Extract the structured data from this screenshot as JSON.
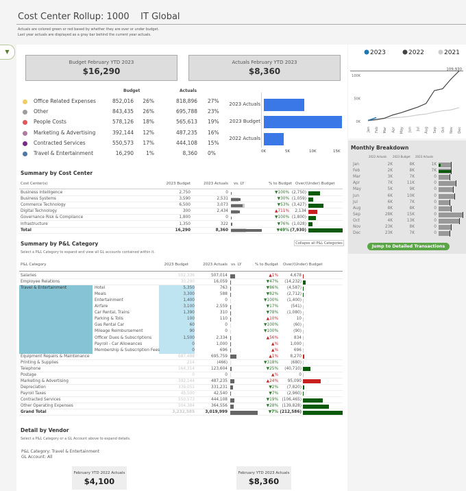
{
  "header": {
    "title": "Cost Center Rollup: 1000    IT Global",
    "note1": "Actuals are colored green or red based by whether they are over or under budget.",
    "note2": "Last year actuals are displayed as a gray bar behind the current year actuals.",
    "filter_icon": "filter-icon"
  },
  "kpis": [
    {
      "label": "Budget February YTD 2023",
      "value": "$16,290"
    },
    {
      "label": "Actuals February YTD 2023",
      "value": "$8,360"
    }
  ],
  "summary": {
    "budget_header": "Budget",
    "actuals_header": "Actuals",
    "rows": [
      {
        "label": "Office Related Expenses",
        "budget": "852,016",
        "bpct": "26%",
        "actual": "818,896",
        "apct": "27%",
        "color": "#f1ce63"
      },
      {
        "label": "Other",
        "budget": "843,435",
        "bpct": "26%",
        "actual": "695,788",
        "apct": "23%",
        "color": "#9d9d9d"
      },
      {
        "label": "People Costs",
        "budget": "578,126",
        "bpct": "18%",
        "actual": "565,613",
        "apct": "19%",
        "color": "#e15759"
      },
      {
        "label": "Marketing & Advertising",
        "budget": "392,144",
        "bpct": "12%",
        "actual": "487,235",
        "apct": "16%",
        "color": "#b07aa1"
      },
      {
        "label": "Contracted Services",
        "budget": "550,573",
        "bpct": "17%",
        "actual": "444,108",
        "apct": "15%",
        "color": "#7b2a8c"
      },
      {
        "label": "Travel & Entertainment",
        "budget": "16,290",
        "bpct": "1%",
        "actual": "8,360",
        "apct": "0%",
        "color": "#4e79a7"
      }
    ]
  },
  "ytd_chart": {
    "bars": [
      {
        "label": "2023 Actuals",
        "value": 8360
      },
      {
        "label": "2023 Budget",
        "value": 16290
      },
      {
        "label": "2022 Actuals",
        "value": 4100
      }
    ],
    "ticks": [
      "0K",
      "5K",
      "10K",
      "15K"
    ],
    "max": 15000,
    "color": "#3b78e7"
  },
  "cost_center": {
    "title": "Summary by Cost Center",
    "headers": [
      "Cost Center(s)",
      "2023 Budget",
      "2023 Actuals",
      "vs. LY",
      "% to Budget",
      "Over/(Under) Budget"
    ],
    "rows": [
      {
        "name": "Business Intelligence",
        "budget": "2,750",
        "actual": "0",
        "ly": 0,
        "lyprev": 0,
        "pct": "▼100%",
        "up": false,
        "over": "(2,750)",
        "ov": -2750
      },
      {
        "name": "Business Systems",
        "budget": "3,590",
        "actual": "2,531",
        "ly": 2531,
        "lyprev": 2000,
        "pct": "▼30%",
        "up": false,
        "over": "(1,059)",
        "ov": -1059
      },
      {
        "name": "Commerce Technology",
        "budget": "6,500",
        "actual": "3,073",
        "ly": 3073,
        "lyprev": 3700,
        "pct": "▼53%",
        "up": false,
        "over": "(3,427)",
        "ov": -3427
      },
      {
        "name": "Digital Technology",
        "budget": "300",
        "actual": "2,434",
        "ly": 2434,
        "lyprev": 1800,
        "pct": "▲711%",
        "up": true,
        "over": "2,134",
        "ov": 2134
      },
      {
        "name": "Governance Risk & Compliance",
        "budget": "1,800",
        "actual": "0",
        "ly": 0,
        "lyprev": 0,
        "pct": "▼100%",
        "up": false,
        "over": "(1,800)",
        "ov": -1800
      },
      {
        "name": "Infrastructure",
        "budget": "1,350",
        "actual": "322",
        "ly": 322,
        "lyprev": 300,
        "pct": "▼76%",
        "up": false,
        "over": "(1,028)",
        "ov": -1028
      },
      {
        "name": "Total",
        "budget": "16,290",
        "actual": "8,360",
        "ly": 8360,
        "lyprev": 4100,
        "pct": "▼49%",
        "up": false,
        "over": "(7,930)",
        "ov": -7930,
        "bold": true
      }
    ]
  },
  "pl": {
    "title": "Summary by P&L Category",
    "subtitle": "Select a P&L Category to expand and view all GL accounts contained within it.",
    "collapse_label": "Collapse all P&L Categories",
    "headers": [
      "P&L Category",
      "2023 Budget",
      "2023 Actuals",
      "vs. LY",
      "% to Budget",
      "Over/(Under) Budget"
    ],
    "expanded_category": "Travel & Entertainment",
    "rows": [
      {
        "cat": "Salaries",
        "budget": "502,336",
        "actual": "507,014",
        "ly": 507014,
        "pct": "▲1%",
        "up": true,
        "over": "4,678",
        "ov": 4678
      },
      {
        "cat": "Employee Relations",
        "budget": "30,290",
        "actual": "16,059",
        "ly": 16059,
        "pct": "▼47%",
        "up": false,
        "over": "(14,232)",
        "ov": -14232
      },
      {
        "sub": "Hotel",
        "budget": "5,350",
        "actual": "763",
        "ly": 763,
        "pct": "▼86%",
        "up": false,
        "over": "(4,587)",
        "ov": -4587
      },
      {
        "sub": "Meals",
        "budget": "3,300",
        "actual": "588",
        "ly": 588,
        "pct": "▼82%",
        "up": false,
        "over": "(2,712)",
        "ov": -2712
      },
      {
        "sub": "Entertainment",
        "budget": "1,400",
        "actual": "0",
        "ly": 0,
        "pct": "▼100%",
        "up": false,
        "over": "(1,400)",
        "ov": -1400
      },
      {
        "sub": "Airfare",
        "budget": "3,100",
        "actual": "2,559",
        "ly": 2559,
        "pct": "▼17%",
        "up": false,
        "over": "(541)",
        "ov": -541
      },
      {
        "sub": "Car Rental, Trains",
        "budget": "1,390",
        "actual": "310",
        "ly": 310,
        "pct": "▼78%",
        "up": false,
        "over": "(1,080)",
        "ov": -1080
      },
      {
        "sub": "Parking & Tolls",
        "budget": "100",
        "actual": "110",
        "ly": 110,
        "pct": "▲10%",
        "up": true,
        "over": "10",
        "ov": 10
      },
      {
        "sub": "Gas Rental Car",
        "budget": "60",
        "actual": "0",
        "ly": 0,
        "pct": "▼100%",
        "up": false,
        "over": "(60)",
        "ov": -60
      },
      {
        "sub": "Mileage Reimbursement",
        "budget": "90",
        "actual": "0",
        "ly": 0,
        "pct": "▼100%",
        "up": false,
        "over": "(90)",
        "ov": -90
      },
      {
        "sub": "Officer Dues & Subscriptions",
        "budget": "1,500",
        "actual": "2,334",
        "ly": 2334,
        "pct": "▲56%",
        "up": true,
        "over": "834",
        "ov": 834
      },
      {
        "sub": "Payroll - Car Allowances",
        "budget": "0",
        "actual": "1,000",
        "ly": 1000,
        "pct": "▲%",
        "up": true,
        "over": "1,000",
        "ov": 1000
      },
      {
        "sub": "Membership & Subscription Fees",
        "budget": "0",
        "actual": "696",
        "ly": 696,
        "pct": "▲%",
        "up": true,
        "over": "696",
        "ov": 696
      },
      {
        "cat": "Equipment Repairs & Maintenance",
        "budget": "687,488",
        "actual": "695,759",
        "ly": 695759,
        "pct": "▲1%",
        "up": true,
        "over": "8,270",
        "ov": 8270
      },
      {
        "cat": "Printing & Supplies",
        "budget": "214",
        "actual": "(466)",
        "ly": 0,
        "pct": "▼318%",
        "up": false,
        "over": "(680)",
        "ov": -680
      },
      {
        "cat": "Telephone",
        "budget": "164,314",
        "actual": "123,604",
        "ly": 123604,
        "pct": "▼25%",
        "up": false,
        "over": "(40,710)",
        "ov": -40710
      },
      {
        "cat": "Postage",
        "budget": "0",
        "actual": "0",
        "ly": 0,
        "pct": "▲%",
        "up": true,
        "over": "0",
        "ov": 0
      },
      {
        "cat": "Marketing & Advertising",
        "budget": "392,144",
        "actual": "487,235",
        "ly": 487235,
        "pct": "▲24%",
        "up": true,
        "over": "95,090",
        "ov": 95090
      },
      {
        "cat": "Depreciation",
        "budget": "339,051",
        "actual": "331,231",
        "ly": 331231,
        "pct": "▼2%",
        "up": false,
        "over": "(7,820)",
        "ov": -7820
      },
      {
        "cat": "Payroll Taxes",
        "budget": "45,500",
        "actual": "42,540",
        "ly": 42540,
        "pct": "▼7%",
        "up": false,
        "over": "(2,960)",
        "ov": -2960
      },
      {
        "cat": "Contracted Services",
        "budget": "550,573",
        "actual": "444,108",
        "ly": 444108,
        "pct": "▼19%",
        "up": false,
        "over": "(106,465)",
        "ov": -106465
      },
      {
        "cat": "Other Operating Expenses",
        "budget": "504,384",
        "actual": "364,556",
        "ly": 364556,
        "pct": "▼28%",
        "up": false,
        "over": "(139,828)",
        "ov": -139828
      },
      {
        "cat": "Grand Total",
        "budget": "3,232,585",
        "actual": "3,019,999",
        "ly": 3019999,
        "pct": "▼7%",
        "up": false,
        "over": "(212,586)",
        "ov": -212586,
        "bold": true
      }
    ]
  },
  "vendor": {
    "title": "Detail by Vendor",
    "subtitle": "Select a P&L Category or a GL Account above to expand details.",
    "category": "P&L Category: Travel & Entertainment",
    "account": "GL Account: All",
    "kpis": [
      {
        "label": "February YTD 2022 Actuals",
        "value": "$4,100"
      },
      {
        "label": "February YTD 2023 Actuals",
        "value": "$8,360"
      }
    ]
  },
  "chart_data": {
    "type": "line",
    "title": "Cumulative Actuals by Month",
    "x": [
      "Jan",
      "Feb",
      "Mar",
      "Apr",
      "May",
      "Jun",
      "Jul",
      "Aug",
      "Sep",
      "Oct",
      "Nov",
      "Dec"
    ],
    "y_ticks": [
      "0K",
      "50K",
      "100K"
    ],
    "ylim": [
      0,
      110000
    ],
    "reference_label": "109,930",
    "reference_value": 109930,
    "series": [
      {
        "name": "2023",
        "color": "#1f77b4",
        "values": [
          2000,
          8360
        ]
      },
      {
        "name": "2022",
        "color": "#444444",
        "values": [
          2000,
          4100,
          7000,
          14000,
          19000,
          25000,
          31000,
          39000,
          67000,
          71000,
          92000,
          109930
        ]
      },
      {
        "name": "2021",
        "color": "#cccccc",
        "values": [
          1000,
          3000,
          6000,
          8000,
          9000,
          11000,
          14000,
          16000,
          20000,
          23000,
          25000,
          30000
        ]
      }
    ]
  },
  "monthly": {
    "title": "Monthly Breakdown",
    "headers": [
      "2022 Actuals",
      "2023 Budget",
      "2023 Actuals"
    ],
    "jump_label": "Jump to Detailed Transactions",
    "rows": [
      {
        "m": "Jan",
        "a22": "2K",
        "b": "8K",
        "a23": "1K",
        "bv": 8,
        "av": 1
      },
      {
        "m": "Feb",
        "a22": "2K",
        "b": "8K",
        "a23": "7K",
        "bv": 8,
        "av": 7
      },
      {
        "m": "Mar",
        "a22": "3K",
        "b": "7K",
        "a23": "0",
        "bv": 7,
        "av": 0
      },
      {
        "m": "Apr",
        "a22": "7K",
        "b": "11K",
        "a23": "0",
        "bv": 11,
        "av": 0
      },
      {
        "m": "May",
        "a22": "5K",
        "b": "9K",
        "a23": "0",
        "bv": 9,
        "av": 0
      },
      {
        "m": "Jun",
        "a22": "6K",
        "b": "10K",
        "a23": "0",
        "bv": 10,
        "av": 0
      },
      {
        "m": "Jul",
        "a22": "6K",
        "b": "7K",
        "a23": "0",
        "bv": 7,
        "av": 0
      },
      {
        "m": "Aug",
        "a22": "8K",
        "b": "8K",
        "a23": "0",
        "bv": 8,
        "av": 0
      },
      {
        "m": "Sep",
        "a22": "28K",
        "b": "15K",
        "a23": "0",
        "bv": 15,
        "av": 0
      },
      {
        "m": "Oct",
        "a22": "4K",
        "b": "13K",
        "a23": "0",
        "bv": 13,
        "av": 0
      },
      {
        "m": "Nov",
        "a22": "23K",
        "b": "8K",
        "a23": "0",
        "bv": 8,
        "av": 0
      },
      {
        "m": "Dec",
        "a22": "23K",
        "b": "7K",
        "a23": "0",
        "bv": 7,
        "av": 0
      }
    ]
  },
  "colors": {
    "under": "#0b5a0b",
    "over": "#c8201e",
    "ly": "#666666"
  }
}
